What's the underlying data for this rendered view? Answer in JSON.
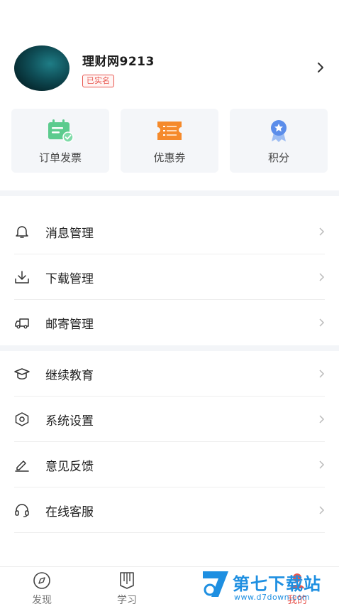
{
  "profile": {
    "username": "理财网9213",
    "verified_badge": "已实名",
    "avatar_icon": "avatar-image",
    "arrow_icon": "chevron-right-icon"
  },
  "quick_actions": [
    {
      "label": "订单发票",
      "icon": "invoice-icon",
      "color": "#5ccb8e"
    },
    {
      "label": "优惠券",
      "icon": "coupon-icon",
      "color": "#f58a2b"
    },
    {
      "label": "积分",
      "icon": "medal-icon",
      "color": "#5b8dea"
    }
  ],
  "menu_group_1": [
    {
      "label": "消息管理",
      "icon": "bell-icon"
    },
    {
      "label": "下载管理",
      "icon": "download-icon"
    },
    {
      "label": "邮寄管理",
      "icon": "truck-icon"
    }
  ],
  "menu_group_2": [
    {
      "label": "继续教育",
      "icon": "graduation-cap-icon"
    },
    {
      "label": "系统设置",
      "icon": "settings-icon"
    },
    {
      "label": "意见反馈",
      "icon": "edit-icon"
    },
    {
      "label": "在线客服",
      "icon": "headset-icon"
    }
  ],
  "tabbar": {
    "tabs": [
      {
        "label": "发现",
        "icon": "compass-icon",
        "active": false
      },
      {
        "label": "学习",
        "icon": "book-icon",
        "active": false
      },
      {
        "label": "我的",
        "icon": "user-icon",
        "active": true
      }
    ]
  },
  "watermark": {
    "title": "第七下载站",
    "url": "www.d7down.com"
  },
  "colors": {
    "accent": "#e8564f",
    "watermark": "#1e8fe1"
  }
}
